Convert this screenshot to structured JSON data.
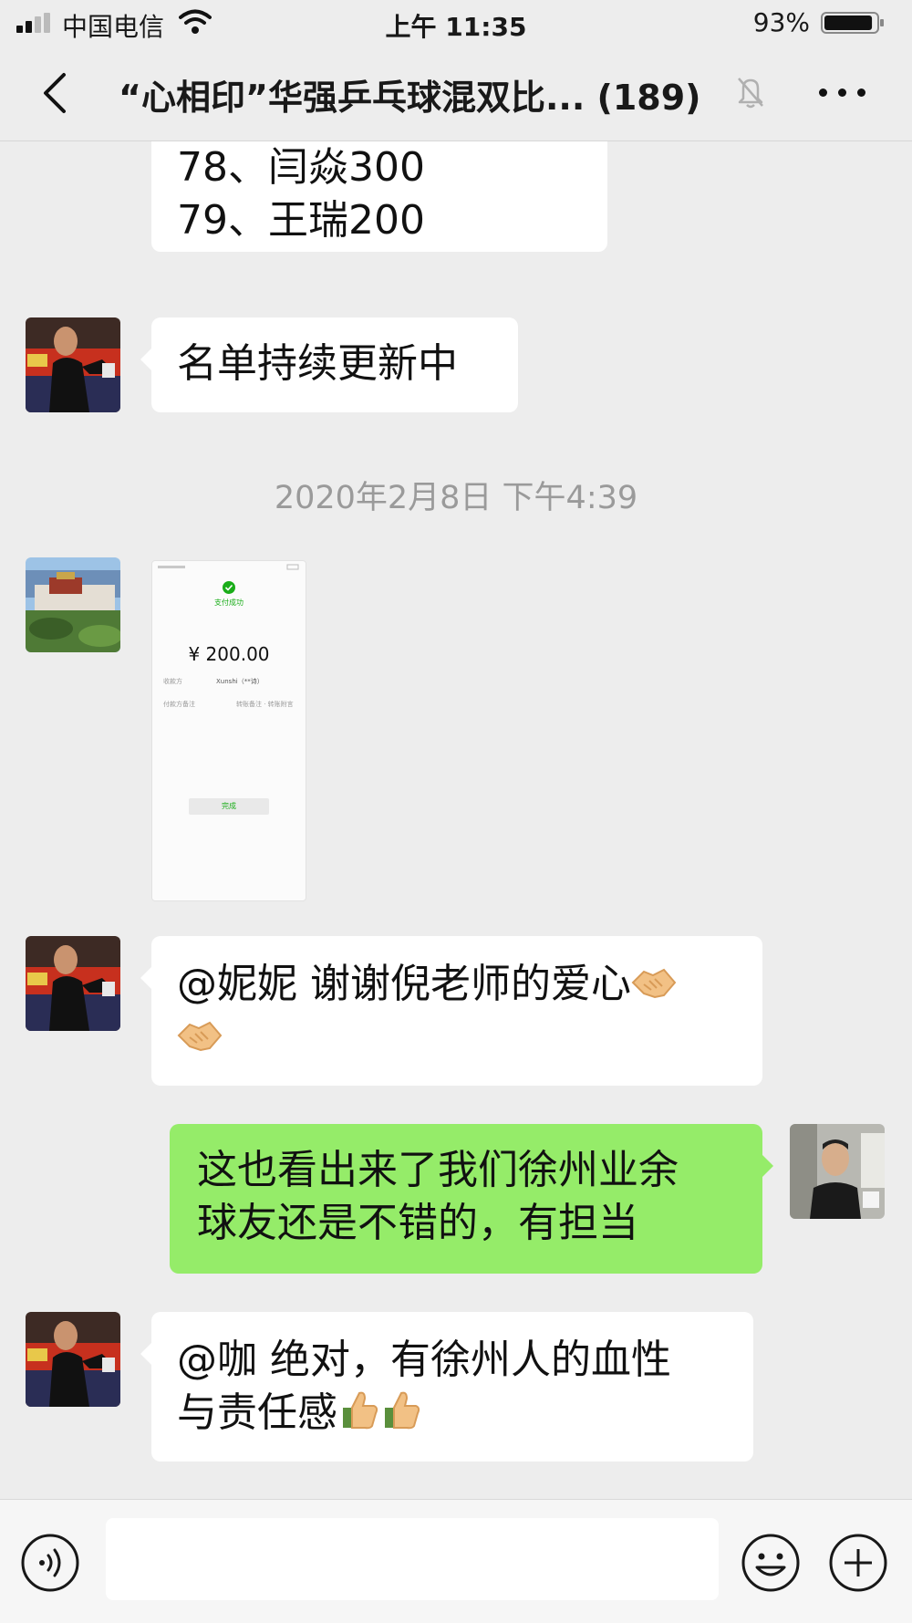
{
  "status_bar": {
    "carrier": "中国电信",
    "time": "上午 11:35",
    "battery": "93%",
    "battery_level": 0.93
  },
  "header": {
    "title": "“心相印”华强乒乓球混双比... (189)",
    "back_icon": "chevron-left-icon",
    "mute_icon": "bell-muted-icon",
    "more_icon": "more-dots-icon"
  },
  "messages": [
    {
      "type": "text",
      "direction": "in",
      "lines": [
        "78、闫焱300",
        "79、王瑞200"
      ]
    },
    {
      "type": "text",
      "direction": "in",
      "lines": [
        "名单持续更新中"
      ]
    },
    {
      "type": "timestamp",
      "text": "2020年2月8日 下午4:39"
    },
    {
      "type": "image",
      "direction": "in",
      "content": {
        "header": "支付成功",
        "amount": "¥ 200.00",
        "payee_label": "收款方",
        "payee": "Xunshi（**诗）",
        "remark_label": "付款方备注",
        "remark_action": "转账备注 · 转账附言",
        "button": "完成"
      }
    },
    {
      "type": "text",
      "direction": "in",
      "lines": [
        "@妮妮 谢谢倪老师的爱心",
        ""
      ],
      "emojis": [
        "handshake",
        "handshake"
      ]
    },
    {
      "type": "text",
      "direction": "out",
      "lines": [
        "这也看出来了我们徐州业余",
        "球友还是不错的，有担当"
      ]
    },
    {
      "type": "text",
      "direction": "in",
      "lines": [
        "@咖 绝对，有徐州人的血性",
        "与责任感"
      ],
      "emojis": [
        "thumbs-up",
        "thumbs-up"
      ]
    }
  ],
  "input_bar": {
    "placeholder": "",
    "voice_icon": "voice-icon",
    "emoji_icon": "emoji-icon",
    "add_icon": "add-circle-icon"
  },
  "colors": {
    "background": "#ededed",
    "outgoing_bubble": "#95ec69",
    "incoming_bubble": "#ffffff",
    "timestamp_text": "#9a9a9a"
  }
}
